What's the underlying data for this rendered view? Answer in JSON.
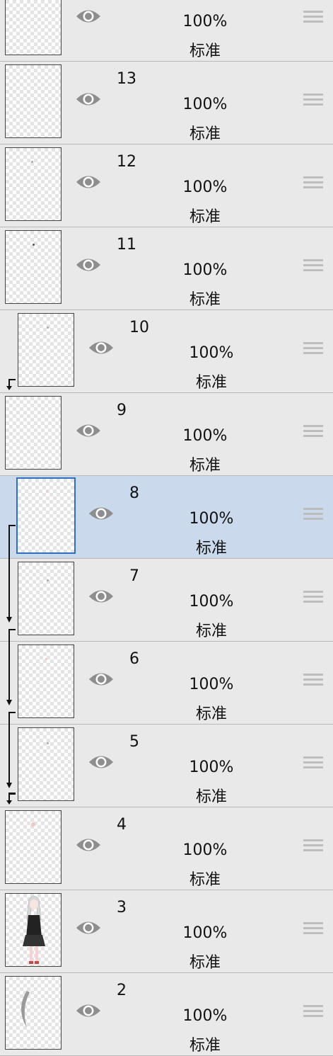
{
  "layers": [
    {
      "name": "",
      "opacity": "100%",
      "blend": "标准",
      "clipped": false,
      "selected": false
    },
    {
      "name": "13",
      "opacity": "100%",
      "blend": "标准",
      "clipped": false,
      "selected": false
    },
    {
      "name": "12",
      "opacity": "100%",
      "blend": "标准",
      "clipped": false,
      "selected": false
    },
    {
      "name": "11",
      "opacity": "100%",
      "blend": "标准",
      "clipped": false,
      "selected": false
    },
    {
      "name": "10",
      "opacity": "100%",
      "blend": "标准",
      "clipped": true,
      "selected": false
    },
    {
      "name": "9",
      "opacity": "100%",
      "blend": "标准",
      "clipped": false,
      "selected": false
    },
    {
      "name": "8",
      "opacity": "100%",
      "blend": "标准",
      "clipped": true,
      "selected": true
    },
    {
      "name": "7",
      "opacity": "100%",
      "blend": "标准",
      "clipped": true,
      "selected": false
    },
    {
      "name": "6",
      "opacity": "100%",
      "blend": "标准",
      "clipped": true,
      "selected": false
    },
    {
      "name": "5",
      "opacity": "100%",
      "blend": "标准",
      "clipped": true,
      "selected": false
    },
    {
      "name": "4",
      "opacity": "100%",
      "blend": "标准",
      "clipped": false,
      "selected": false
    },
    {
      "name": "3",
      "opacity": "100%",
      "blend": "标准",
      "clipped": false,
      "selected": false
    },
    {
      "name": "2",
      "opacity": "100%",
      "blend": "标准",
      "clipped": false,
      "selected": false
    }
  ],
  "colors": {
    "background": "#e9e9e9",
    "selected_row": "#cbd9ec",
    "selected_border": "#2f6fc2",
    "icon_gray": "#8e8e8e"
  },
  "icons": {
    "visibility": "eye-icon",
    "reorder": "drag-handle-icon",
    "clipping": "clip-arrow-icon"
  }
}
